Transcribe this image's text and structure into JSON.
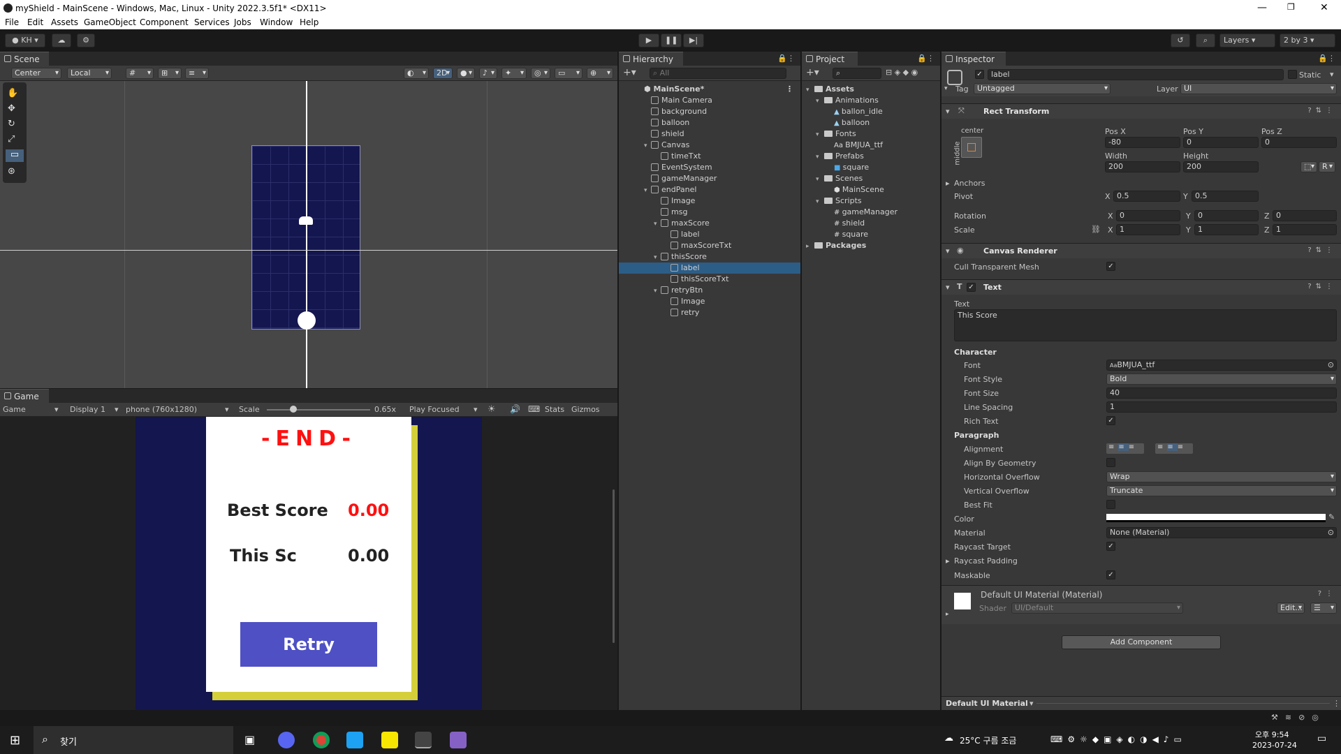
{
  "window": {
    "title": "myShield - MainScene - Windows, Mac, Linux - Unity 2022.3.5f1* <DX11>"
  },
  "menu": [
    "File",
    "Edit",
    "Assets",
    "GameObject",
    "Component",
    "Services",
    "Jobs",
    "Window",
    "Help"
  ],
  "toolbar": {
    "account": "KH",
    "layers": "Layers",
    "layout": "2 by 3"
  },
  "scene": {
    "tab": "Scene",
    "pivot": "Center",
    "space": "Local",
    "mode2d": "2D"
  },
  "game": {
    "tab": "Game",
    "view": "Game",
    "display": "Display 1",
    "resolution": "phone (760x1280)",
    "scale_label": "Scale",
    "scale_value": "0.65x",
    "play_mode": "Play Focused",
    "stats": "Stats",
    "gizmos": "Gizmos",
    "canvas": {
      "end_title": "-END-",
      "best_label": "Best Score",
      "best_value": "0.00",
      "this_label": "This Sc",
      "this_value": "0.00",
      "retry": "Retry"
    }
  },
  "hierarchy": {
    "tab": "Hierarchy",
    "search": "All",
    "scene": "MainScene*",
    "items": [
      {
        "label": "Main Camera",
        "depth": 1
      },
      {
        "label": "background",
        "depth": 1
      },
      {
        "label": "balloon",
        "depth": 1
      },
      {
        "label": "shield",
        "depth": 1
      },
      {
        "label": "Canvas",
        "depth": 1,
        "expanded": true
      },
      {
        "label": "timeTxt",
        "depth": 2
      },
      {
        "label": "EventSystem",
        "depth": 1
      },
      {
        "label": "gameManager",
        "depth": 1
      },
      {
        "label": "endPanel",
        "depth": 1,
        "expanded": true
      },
      {
        "label": "Image",
        "depth": 2
      },
      {
        "label": "msg",
        "depth": 2
      },
      {
        "label": "maxScore",
        "depth": 2,
        "expanded": true
      },
      {
        "label": "label",
        "depth": 3
      },
      {
        "label": "maxScoreTxt",
        "depth": 3
      },
      {
        "label": "thisScore",
        "depth": 2,
        "expanded": true
      },
      {
        "label": "label",
        "depth": 3,
        "selected": true
      },
      {
        "label": "thisScoreTxt",
        "depth": 3
      },
      {
        "label": "retryBtn",
        "depth": 2,
        "expanded": true
      },
      {
        "label": "Image",
        "depth": 3
      },
      {
        "label": "retry",
        "depth": 3
      }
    ]
  },
  "project": {
    "tab": "Project",
    "items": [
      {
        "label": "Assets",
        "depth": 0,
        "type": "folder",
        "bold": true
      },
      {
        "label": "Animations",
        "depth": 1,
        "type": "folder"
      },
      {
        "label": "ballon_idle",
        "depth": 2,
        "type": "anim"
      },
      {
        "label": "balloon",
        "depth": 2,
        "type": "anim"
      },
      {
        "label": "Fonts",
        "depth": 1,
        "type": "folder"
      },
      {
        "label": "BMJUA_ttf",
        "depth": 2,
        "type": "font"
      },
      {
        "label": "Prefabs",
        "depth": 1,
        "type": "folder"
      },
      {
        "label": "square",
        "depth": 2,
        "type": "prefab"
      },
      {
        "label": "Scenes",
        "depth": 1,
        "type": "folder"
      },
      {
        "label": "MainScene",
        "depth": 2,
        "type": "scene"
      },
      {
        "label": "Scripts",
        "depth": 1,
        "type": "folder"
      },
      {
        "label": "gameManager",
        "depth": 2,
        "type": "script"
      },
      {
        "label": "shield",
        "depth": 2,
        "type": "script"
      },
      {
        "label": "square",
        "depth": 2,
        "type": "script"
      },
      {
        "label": "Packages",
        "depth": 0,
        "type": "folder",
        "bold": true
      }
    ]
  },
  "inspector": {
    "tab": "Inspector",
    "name": "label",
    "static": "Static",
    "tag_label": "Tag",
    "tag": "Untagged",
    "layer_label": "Layer",
    "layer": "UI",
    "rect": {
      "title": "Rect Transform",
      "anchor_h": "center",
      "anchor_v": "middle",
      "posx_label": "Pos X",
      "posy_label": "Pos Y",
      "posz_label": "Pos Z",
      "posx": "-80",
      "posy": "0",
      "posz": "0",
      "width_label": "Width",
      "height_label": "Height",
      "width": "200",
      "height": "200",
      "anchors": "Anchors",
      "pivot": "Pivot",
      "pivot_x": "0.5",
      "pivot_y": "0.5",
      "rotation": "Rotation",
      "rot_x": "0",
      "rot_y": "0",
      "rot_z": "0",
      "scale": "Scale",
      "scale_x": "1",
      "scale_y": "1",
      "scale_z": "1"
    },
    "canvas_renderer": {
      "title": "Canvas Renderer",
      "cull": "Cull Transparent Mesh"
    },
    "text": {
      "title": "Text",
      "text_label": "Text",
      "value": "This Score",
      "character": "Character",
      "font_label": "Font",
      "font": "BMJUA_ttf",
      "style_label": "Font Style",
      "style": "Bold",
      "size_label": "Font Size",
      "size": "40",
      "spacing_label": "Line Spacing",
      "spacing": "1",
      "rich_label": "Rich Text",
      "paragraph": "Paragraph",
      "alignment": "Alignment",
      "align_geo": "Align By Geometry",
      "hov_label": "Horizontal Overflow",
      "hov": "Wrap",
      "vov_label": "Vertical Overflow",
      "vov": "Truncate",
      "bestfit": "Best Fit",
      "color": "Color",
      "material_label": "Material",
      "material": "None (Material)",
      "raycast": "Raycast Target",
      "padding": "Raycast Padding",
      "maskable": "Maskable"
    },
    "material": {
      "name": "Default UI Material (Material)",
      "shader_label": "Shader",
      "shader": "UI/Default",
      "edit": "Edit..."
    },
    "add_component": "Add Component",
    "footer": "Default UI Material"
  },
  "taskbar": {
    "search": "찾기",
    "weather": "25°C 구름 조금",
    "time": "오후 9:54",
    "date": "2023-07-24"
  }
}
